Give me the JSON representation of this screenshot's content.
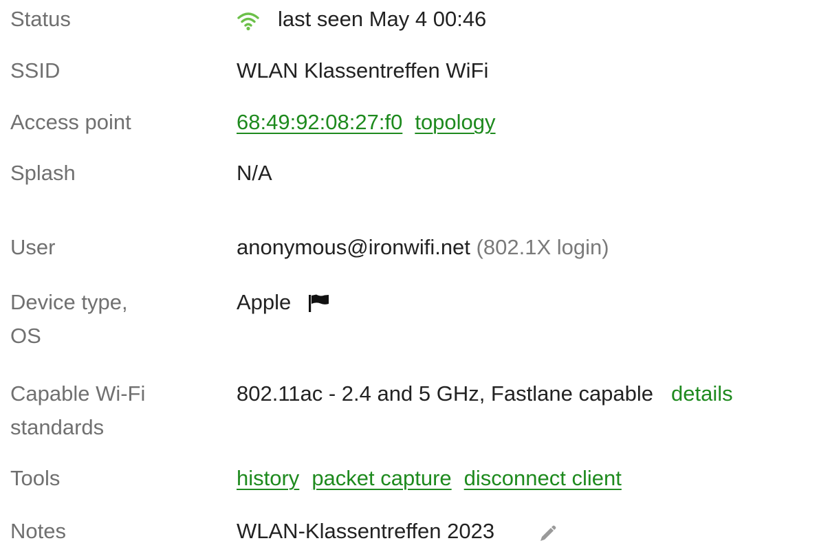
{
  "rows": {
    "status": {
      "label": "Status",
      "text": "last seen May 4 00:46",
      "icon": "wifi-icon",
      "icon_color": "#6cc04a"
    },
    "ssid": {
      "label": "SSID",
      "value": "WLAN Klassentreffen WiFi"
    },
    "access_point": {
      "label": "Access point",
      "mac": "68:49:92:08:27:f0",
      "topology": "topology"
    },
    "splash": {
      "label": "Splash",
      "value": "N/A"
    },
    "user": {
      "label": "User",
      "value": "anonymous@ironwifi.net",
      "note": "(802.1X login)"
    },
    "device": {
      "label_line1": "Device type,",
      "label_line2": "OS",
      "value": "Apple",
      "icon": "flag-icon"
    },
    "wifi_standards": {
      "label_line1": "Capable Wi-Fi",
      "label_line2": "standards",
      "value": "802.11ac - 2.4 and 5 GHz, Fastlane capable",
      "details": "details"
    },
    "tools": {
      "label": "Tools",
      "history": "history",
      "packet_capture": "packet capture",
      "disconnect": "disconnect client"
    },
    "notes": {
      "label": "Notes",
      "value": "WLAN-Klassentreffen 2023",
      "icon": "pencil-icon"
    }
  },
  "colors": {
    "link": "#1e8a1e",
    "label": "#707070",
    "text": "#222222",
    "muted": "#7a7a7a"
  }
}
